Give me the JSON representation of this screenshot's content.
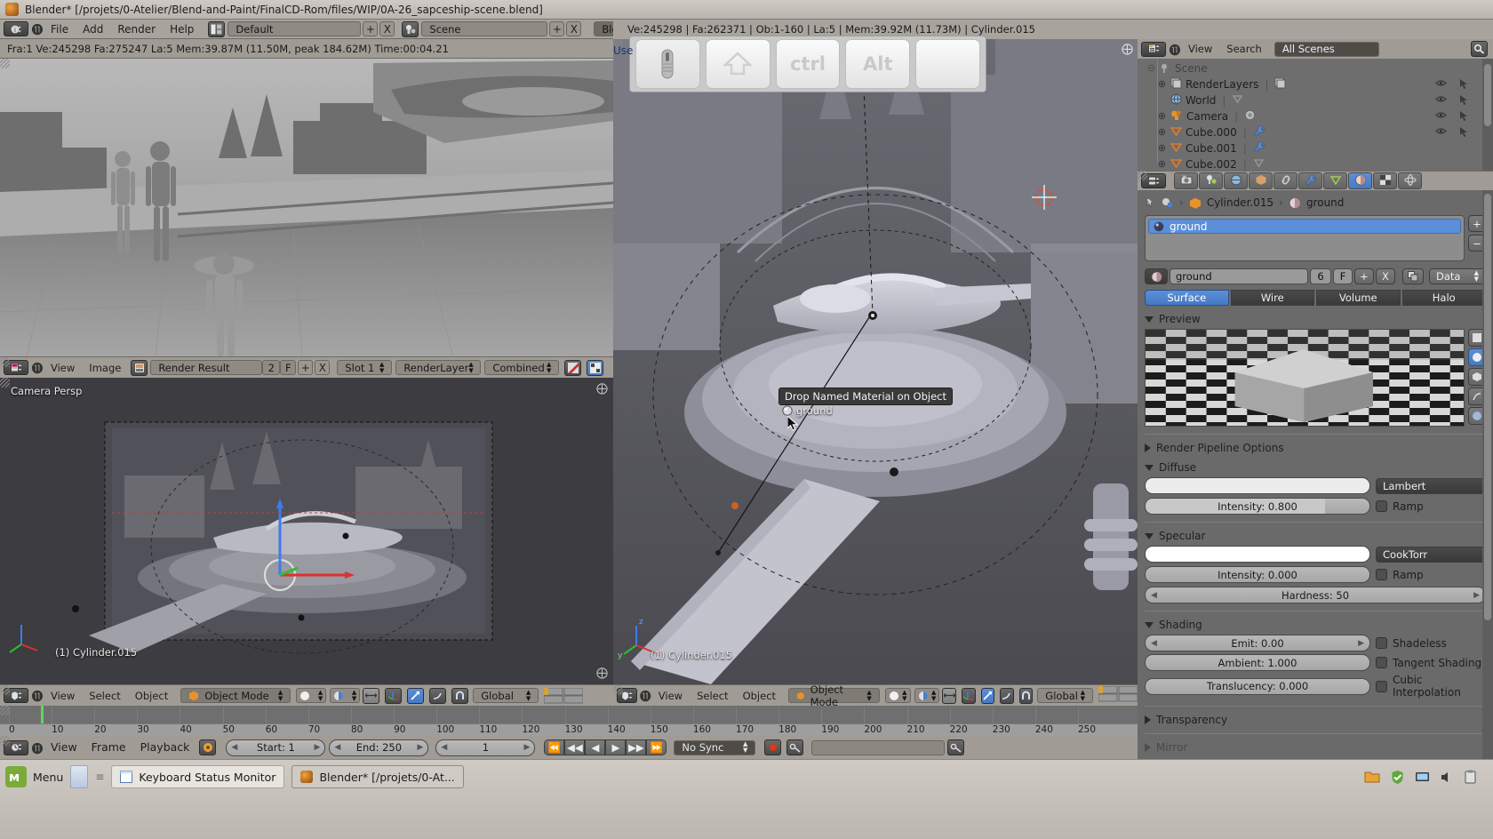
{
  "window": {
    "title": "Blender* [/projets/0-Atelier/Blend-and-Paint/FinalCD-Rom/files/WIP/0A-26_sapceship-scene.blend]",
    "app_icon": "blender-icon"
  },
  "topbar": {
    "editor_type_icon": "info-editor-icon",
    "collapse_icon": "collapse-menu-icon",
    "menus": [
      "File",
      "Add",
      "Render",
      "Help"
    ],
    "screen_layout_icon": "screen-layout-icon",
    "screen_layout": "Default",
    "screen_add": "+",
    "screen_delete": "X",
    "scene_icon": "scene-icon",
    "scene": "Scene",
    "scene_add": "+",
    "scene_delete": "X",
    "render_engine": "Blender Render",
    "render_engine_arrow": "chevron-updown-icon"
  },
  "stats_left": "Fra:1  Ve:245298 Fa:275247 La:5 Mem:39.87M (11.50M, peak 184.62M) Time:00:04.21",
  "stats_right": "Ve:245298 | Fa:262371 | Ob:1-160 | La:5 | Mem:39.92M (11.73M) | Cylinder.015",
  "keyboard_monitor": {
    "label": "Use",
    "keys": [
      {
        "name": "mouse-key",
        "glyph": ""
      },
      {
        "name": "shift-key",
        "glyph": "⇧"
      },
      {
        "name": "ctrl-key",
        "glyph": "ctrl"
      },
      {
        "name": "alt-key",
        "glyph": "Alt"
      },
      {
        "name": "blank-key",
        "glyph": ""
      }
    ]
  },
  "image_editor_header": {
    "editor_icon": "image-editor-icon",
    "collapse_icon": "collapse-menu-icon",
    "menus": [
      "View",
      "Image"
    ],
    "browse_icon": "browse-image-icon",
    "image_name": "Render Result",
    "users": "2",
    "fake_user": "F",
    "add": "+",
    "unlink": "X",
    "slot": "Slot 1",
    "render_layer": "RenderLayer",
    "pass": "Combined",
    "alpha_icon": "alpha-toggle-icon",
    "display_channels_icon": "display-channels-icon",
    "zoom_icon": "zoom-icon"
  },
  "view3d_left": {
    "view_label": "Camera Persp",
    "active_object": "(1) Cylinder.015",
    "header": {
      "editor_icon": "view3d-editor-icon",
      "collapse_icon": "collapse-menu-icon",
      "menus": [
        "View",
        "Select",
        "Object"
      ],
      "mode_icon": "object-mode-icon",
      "mode": "Object Mode",
      "shading_icon": "solid-shading-icon",
      "pivot_icon": "pivot-icon",
      "snap_icon": "snap-icon",
      "manipulator_icons": [
        "translate-manipulator-icon",
        "rotate-manipulator-icon",
        "scale-manipulator-icon"
      ],
      "orientation": "Global",
      "layers_icon": "scene-layers-icon"
    }
  },
  "view3d_right": {
    "active_object": "(1) Cylinder.015",
    "tooltip": "Drop Named Material on Object",
    "drag_label": "ground",
    "drag_icon": "material-sphere-icon",
    "header": {
      "editor_icon": "view3d-editor-icon",
      "collapse_icon": "collapse-menu-icon",
      "menus": [
        "View",
        "Select",
        "Object"
      ],
      "mode_icon": "object-mode-icon",
      "mode": "Object Mode",
      "shading_icon": "solid-shading-icon",
      "pivot_icon": "pivot-icon",
      "snap_icon": "snap-icon",
      "orientation": "Global",
      "layers_icon": "scene-layers-icon"
    }
  },
  "timeline": {
    "ruler_ticks": [
      "0",
      "10",
      "20",
      "30",
      "40",
      "50",
      "60",
      "70",
      "80",
      "90",
      "100",
      "110",
      "120",
      "130",
      "140",
      "150",
      "160",
      "170",
      "180",
      "190",
      "200",
      "210",
      "220",
      "230",
      "240",
      "250"
    ],
    "editor_icon": "timeline-editor-icon",
    "collapse_icon": "collapse-menu-icon",
    "menus": [
      "View",
      "Frame",
      "Playback"
    ],
    "sync_icon": "sync-icon",
    "start_label": "Start: 1",
    "end_label": "End: 250",
    "current_frame": "1",
    "transport": [
      "jump-to-start-icon",
      "prev-keyframe-icon",
      "play-reverse-icon",
      "play-icon",
      "next-keyframe-icon",
      "jump-to-end-icon"
    ],
    "sync_mode": "No Sync",
    "record_icon": "auto-keying-icon",
    "keying_set_icon": "keying-set-icon",
    "keyingset_field": ""
  },
  "outliner": {
    "editor_icon": "outliner-editor-icon",
    "collapse_icon": "collapse-menu-icon",
    "menus": [
      "View",
      "Search"
    ],
    "display_mode": "All Scenes",
    "filter_icon": "search-filter-icon",
    "scene_root": "Scene",
    "items": [
      {
        "label": "RenderLayers",
        "icon": "renderlayers-icon",
        "expandable": true,
        "extra_icon": "renderlayers-data-icon"
      },
      {
        "label": "World",
        "icon": "world-icon",
        "expandable": false,
        "extra_icon": ""
      },
      {
        "label": "Camera",
        "icon": "camera-icon",
        "expandable": true,
        "extra_icon": "camera-data-icon"
      },
      {
        "label": "Cube.000",
        "icon": "mesh-icon",
        "expandable": true,
        "extra_icon": "modifier-icon"
      },
      {
        "label": "Cube.001",
        "icon": "mesh-icon",
        "expandable": true,
        "extra_icon": "modifier-icon"
      },
      {
        "label": "Cube.002",
        "icon": "mesh-icon",
        "expandable": true,
        "extra_icon": ""
      }
    ],
    "restrict_icons": [
      "eye-icon",
      "cursor-icon"
    ]
  },
  "properties": {
    "editor_icon": "properties-editor-icon",
    "tabs": [
      {
        "name": "render-tab",
        "icon": "camera-back-icon",
        "active": false
      },
      {
        "name": "scene-tab",
        "icon": "scene-tab-icon",
        "active": false
      },
      {
        "name": "world-tab",
        "icon": "world-tab-icon",
        "active": false
      },
      {
        "name": "object-tab",
        "icon": "object-cube-icon",
        "active": false
      },
      {
        "name": "constraint-tab",
        "icon": "chain-icon",
        "active": false
      },
      {
        "name": "modifier-tab",
        "icon": "wrench-icon",
        "active": false
      },
      {
        "name": "data-tab",
        "icon": "mesh-data-icon",
        "active": false
      },
      {
        "name": "material-tab",
        "icon": "material-sphere-icon",
        "active": true
      },
      {
        "name": "texture-tab",
        "icon": "texture-checker-icon",
        "active": false
      },
      {
        "name": "physics-tab",
        "icon": "physics-icon",
        "active": false
      }
    ],
    "breadcrumb": {
      "pin_icon": "pin-icon",
      "object_icon": "object-data-icon",
      "object": "Cylinder.015",
      "material_icon": "material-sphere-icon",
      "material": "ground"
    },
    "slot_list": [
      {
        "label": "ground",
        "icon": "material-sphere-icon",
        "selected": true
      }
    ],
    "slot_add": "+",
    "slot_remove": "−",
    "material_datablock": {
      "icon": "material-sphere-icon",
      "name": "ground",
      "users": "6",
      "fake_user": "F",
      "new": "+",
      "unlink": "X",
      "copy_icon": "copy-icon",
      "type": "Data",
      "type_arrow": "chevron-updown-icon"
    },
    "surface_tabs": [
      {
        "label": "Surface",
        "active": true
      },
      {
        "label": "Wire",
        "active": false
      },
      {
        "label": "Volume",
        "active": false
      },
      {
        "label": "Halo",
        "active": false
      }
    ],
    "panels": [
      {
        "name": "preview",
        "label": "Preview",
        "open": true
      },
      {
        "name": "pipeline",
        "label": "Render Pipeline Options",
        "open": false
      },
      {
        "name": "diffuse",
        "label": "Diffuse",
        "open": true
      },
      {
        "name": "specular",
        "label": "Specular",
        "open": true
      },
      {
        "name": "shading",
        "label": "Shading",
        "open": true
      },
      {
        "name": "transparency",
        "label": "Transparency",
        "open": false
      },
      {
        "name": "mirror",
        "label": "Mirror",
        "open": false
      }
    ],
    "preview_render_type_icons": [
      "preview-flat-icon",
      "preview-sphere-icon",
      "preview-cube-icon",
      "preview-hair-icon",
      "preview-sphere-sky-icon"
    ],
    "diffuse": {
      "color": "#ececec",
      "shader": "Lambert",
      "intensity_label": "Intensity: 0.800",
      "intensity_value": 0.8,
      "ramp_label": "Ramp",
      "ramp_checked": false
    },
    "specular": {
      "color": "#ffffff",
      "shader": "CookTorr",
      "intensity_label": "Intensity: 0.000",
      "intensity_value": 0.0,
      "ramp_label": "Ramp",
      "ramp_checked": false,
      "hardness_label": "Hardness: 50"
    },
    "shading": {
      "emit_label": "Emit: 0.00",
      "ambient_label": "Ambient: 1.000",
      "translucency_label": "Translucency: 0.000",
      "shadeless_label": "Shadeless",
      "tangent_label": "Tangent Shading",
      "cubic_label": "Cubic Interpolation"
    }
  },
  "taskbar": {
    "menu_label": "Menu",
    "menu_icon": "mint-menu-icon",
    "show_desktop_icon": "show-desktop-icon",
    "tasks": [
      {
        "label": "Keyboard Status Monitor",
        "icon": "window-icon",
        "active": false
      },
      {
        "label": "Blender* [/projets/0-At...",
        "icon": "blender-icon",
        "active": true
      }
    ],
    "tray_icons": [
      "folder-icon",
      "update-shield-icon",
      "network-icon",
      "volume-icon",
      "clipboard-icon"
    ]
  },
  "colors": {
    "accent_blue": "#4d82d0",
    "header_gray": "#a09c95",
    "panel_gray": "#6a6a6a",
    "viewport_gray": "#55555a"
  }
}
